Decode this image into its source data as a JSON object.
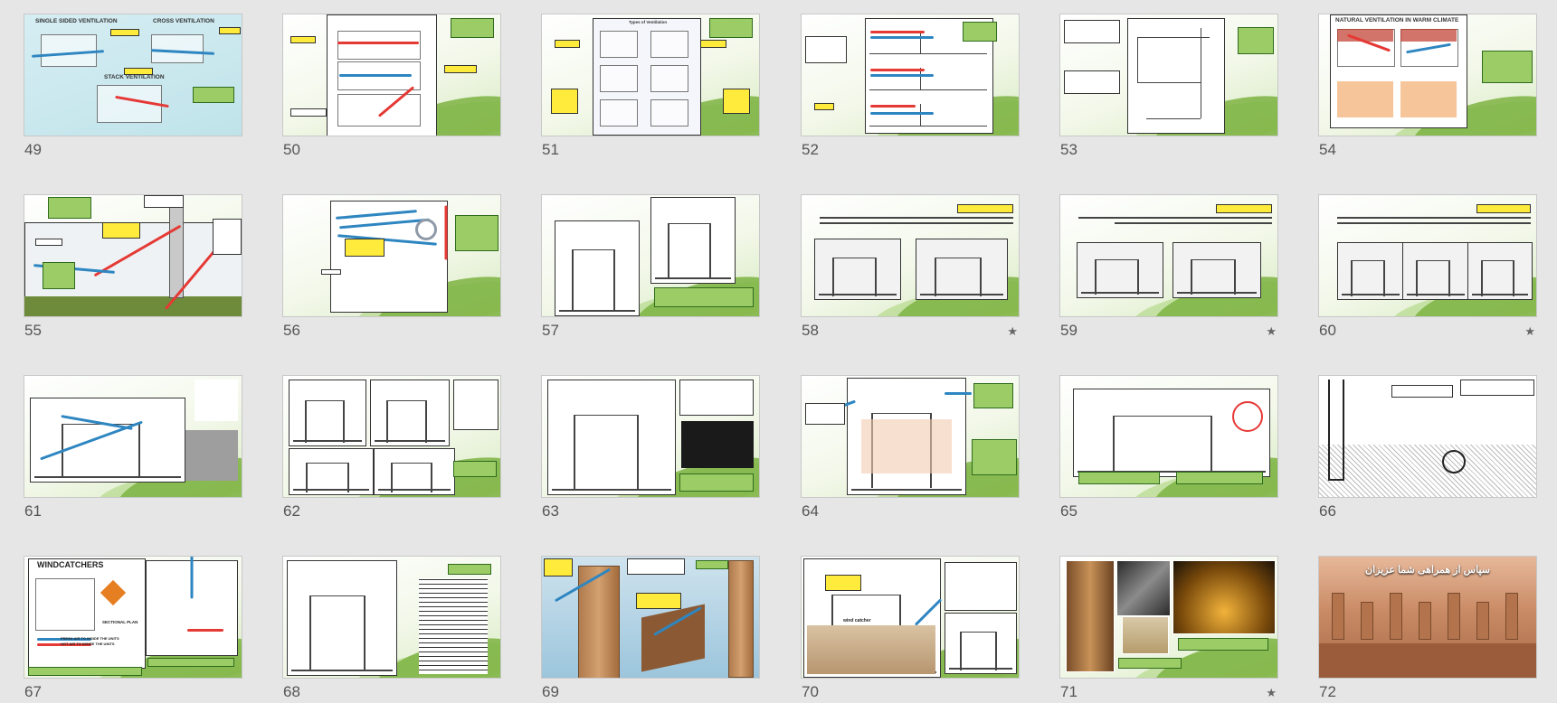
{
  "window": {
    "view": "slide-sorter"
  },
  "colors": {
    "background": "#e6e6e6",
    "accent_green": "#7cb342",
    "label_yellow": "#ffeb3b"
  },
  "slides": [
    {
      "number": "49",
      "starred": false,
      "texts": [
        "SINGLE SIDED VENTILATION",
        "CROSS VENTILATION",
        "STACK VENTILATION"
      ]
    },
    {
      "number": "50",
      "starred": false,
      "texts": [
        "TYPES OF VENTILATION",
        "CROSS VENTILATION",
        "SINGLE SIDED VENTILATION",
        "STACK VENTILATION"
      ]
    },
    {
      "number": "51",
      "starred": false,
      "texts": [
        "Types of Ventilation",
        "Cross Ventilation",
        "Single Sided Ventilation",
        "Stack Ventilation"
      ]
    },
    {
      "number": "52",
      "starred": false,
      "texts": []
    },
    {
      "number": "53",
      "starred": false,
      "texts": []
    },
    {
      "number": "54",
      "starred": false,
      "texts": [
        "NATURAL VENTILATION IN WARM CLIMATE"
      ]
    },
    {
      "number": "55",
      "starred": false,
      "texts": []
    },
    {
      "number": "56",
      "starred": false,
      "texts": []
    },
    {
      "number": "57",
      "starred": false,
      "texts": []
    },
    {
      "number": "58",
      "starred": true,
      "texts": []
    },
    {
      "number": "59",
      "starred": true,
      "texts": []
    },
    {
      "number": "60",
      "starred": true,
      "texts": []
    },
    {
      "number": "61",
      "starred": false,
      "texts": []
    },
    {
      "number": "62",
      "starred": false,
      "texts": []
    },
    {
      "number": "63",
      "starred": false,
      "texts": []
    },
    {
      "number": "64",
      "starred": false,
      "texts": []
    },
    {
      "number": "65",
      "starred": false,
      "texts": []
    },
    {
      "number": "66",
      "starred": false,
      "texts": []
    },
    {
      "number": "67",
      "starred": false,
      "texts": [
        "WINDCATCHERS",
        "SECTIONAL PLAN",
        "FRESH AIR TO INSIDE THE UNITS",
        "HOT AIR TO INSIDE THE UNITS"
      ]
    },
    {
      "number": "68",
      "starred": false,
      "texts": []
    },
    {
      "number": "69",
      "starred": false,
      "texts": []
    },
    {
      "number": "70",
      "starred": false,
      "texts": [
        "wind catcher"
      ]
    },
    {
      "number": "71",
      "starred": true,
      "texts": []
    },
    {
      "number": "72",
      "starred": false,
      "texts": [
        "سپاس از همراهی شما عزیزان"
      ]
    }
  ],
  "star_glyph": "★"
}
